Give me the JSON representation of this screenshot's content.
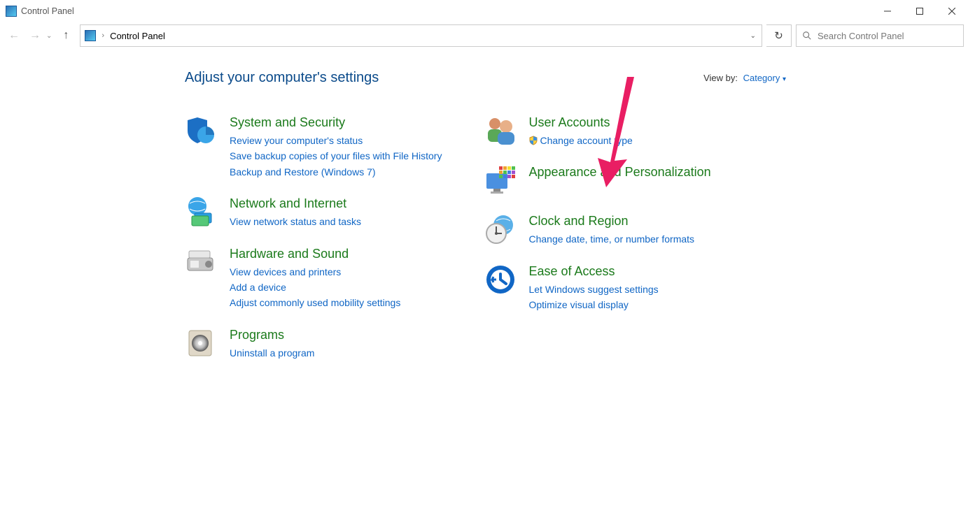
{
  "window": {
    "title": "Control Panel"
  },
  "address": {
    "location": "Control Panel"
  },
  "search": {
    "placeholder": "Search Control Panel"
  },
  "heading": "Adjust your computer's settings",
  "viewby": {
    "label": "View by:",
    "value": "Category"
  },
  "categories": {
    "left": [
      {
        "title": "System and Security",
        "links": [
          "Review your computer's status",
          "Save backup copies of your files with File History",
          "Backup and Restore (Windows 7)"
        ]
      },
      {
        "title": "Network and Internet",
        "links": [
          "View network status and tasks"
        ]
      },
      {
        "title": "Hardware and Sound",
        "links": [
          "View devices and printers",
          "Add a device",
          "Adjust commonly used mobility settings"
        ]
      },
      {
        "title": "Programs",
        "links": [
          "Uninstall a program"
        ]
      }
    ],
    "right": [
      {
        "title": "User Accounts",
        "links": [
          "Change account type"
        ],
        "shield": true
      },
      {
        "title": "Appearance and Personalization",
        "links": []
      },
      {
        "title": "Clock and Region",
        "links": [
          "Change date, time, or number formats"
        ]
      },
      {
        "title": "Ease of Access",
        "links": [
          "Let Windows suggest settings",
          "Optimize visual display"
        ]
      }
    ]
  }
}
